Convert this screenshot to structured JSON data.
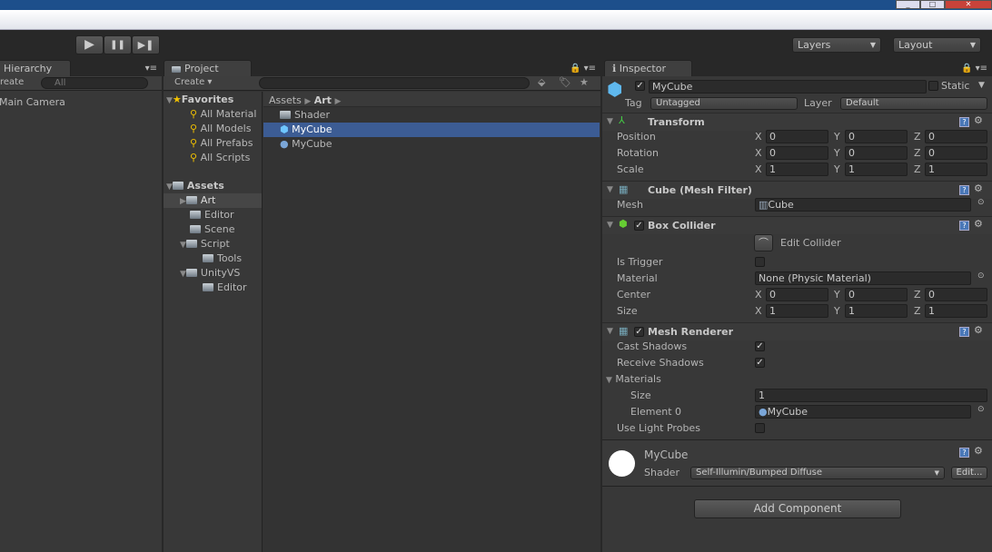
{
  "window": {
    "buttons": [
      "_",
      "□",
      "✕"
    ]
  },
  "toolbar": {
    "play": "▶",
    "pause": "❚❚",
    "step": "▶❚",
    "layers": "Layers",
    "layout": "Layout"
  },
  "hierarchy": {
    "tab": "Hierarchy",
    "create": "reate",
    "search_placeholder": "All",
    "items": [
      "Main Camera"
    ]
  },
  "project": {
    "tab": "Project",
    "create": "Create",
    "favorites": {
      "label": "Favorites",
      "items": [
        "All Material",
        "All Models",
        "All Prefabs",
        "All Scripts"
      ]
    },
    "assets": {
      "label": "Assets",
      "tree": [
        "Art",
        "Editor",
        "Scene",
        "Script",
        "Tools",
        "UnityVS",
        "Editor"
      ]
    },
    "breadcrumb": [
      "Assets",
      "Art"
    ],
    "files": [
      {
        "name": "Shader",
        "icon": "folder-icon"
      },
      {
        "name": "MyCube",
        "icon": "prefab-cube-icon",
        "selected": true
      },
      {
        "name": "MyCube",
        "icon": "material-sphere-icon"
      }
    ]
  },
  "inspector": {
    "tab": "Inspector",
    "name": "MyCube",
    "static": "Static",
    "tag_label": "Tag",
    "tag": "Untagged",
    "layer_label": "Layer",
    "layer": "Default",
    "transform": {
      "title": "Transform",
      "rows": [
        {
          "label": "Position",
          "x": "0",
          "y": "0",
          "z": "0"
        },
        {
          "label": "Rotation",
          "x": "0",
          "y": "0",
          "z": "0"
        },
        {
          "label": "Scale",
          "x": "1",
          "y": "1",
          "z": "1"
        }
      ]
    },
    "mesh_filter": {
      "title": "Cube (Mesh Filter)",
      "mesh_label": "Mesh",
      "mesh": "Cube"
    },
    "box_collider": {
      "title": "Box Collider",
      "edit": "Edit Collider",
      "is_trigger": "Is Trigger",
      "material_label": "Material",
      "material": "None (Physic Material)",
      "center_label": "Center",
      "center": {
        "x": "0",
        "y": "0",
        "z": "0"
      },
      "size_label": "Size",
      "size": {
        "x": "1",
        "y": "1",
        "z": "1"
      }
    },
    "mesh_renderer": {
      "title": "Mesh Renderer",
      "cast": "Cast Shadows",
      "receive": "Receive Shadows",
      "materials": "Materials",
      "size_label": "Size",
      "size": "1",
      "element0_label": "Element 0",
      "element0": "MyCube",
      "light_probes": "Use Light Probes"
    },
    "material": {
      "name": "MyCube",
      "shader_label": "Shader",
      "shader": "Self-Illumin/Bumped Diffuse",
      "edit": "Edit..."
    },
    "add_component": "Add Component",
    "axes": {
      "x": "X",
      "y": "Y",
      "z": "Z"
    }
  }
}
